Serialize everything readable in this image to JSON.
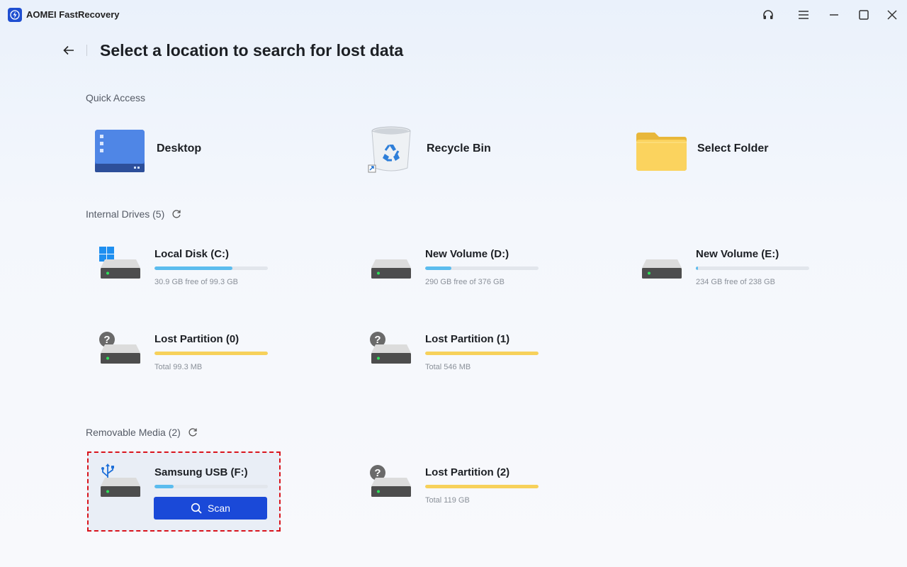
{
  "app": {
    "title": "AOMEI FastRecovery"
  },
  "header": {
    "title": "Select a location to search for lost data"
  },
  "quick_access": {
    "label": "Quick Access",
    "items": [
      {
        "label": "Desktop",
        "icon": "desktop-icon"
      },
      {
        "label": "Recycle Bin",
        "icon": "recycle-bin-icon"
      },
      {
        "label": "Select Folder",
        "icon": "folder-icon"
      }
    ]
  },
  "internal_drives": {
    "label": "Internal Drives (5)",
    "drives": [
      {
        "name": "Local Disk (C:)",
        "info": "30.9 GB free of 99.3 GB",
        "used_fraction": 0.69,
        "bar_color": "#5bbcee",
        "badge": "windows"
      },
      {
        "name": "New Volume (D:)",
        "info": "290 GB free of 376 GB",
        "used_fraction": 0.23,
        "bar_color": "#5bbcee",
        "badge": "none"
      },
      {
        "name": "New Volume (E:)",
        "info": "234 GB free of 238 GB",
        "used_fraction": 0.017,
        "bar_color": "#5bbcee",
        "badge": "none"
      },
      {
        "name": "Lost Partition (0)",
        "info": "Total 99.3 MB",
        "used_fraction": 1.0,
        "bar_color": "#f7d15a",
        "badge": "question"
      },
      {
        "name": "Lost Partition (1)",
        "info": "Total 546 MB",
        "used_fraction": 1.0,
        "bar_color": "#f7d15a",
        "badge": "question"
      }
    ]
  },
  "removable_media": {
    "label": "Removable Media (2)",
    "drives": [
      {
        "name": "Samsung USB (F:)",
        "used_fraction": 0.17,
        "bar_color": "#5bbcee",
        "badge": "usb",
        "selected": true
      },
      {
        "name": "Lost Partition (2)",
        "info": "Total 119 GB",
        "used_fraction": 1.0,
        "bar_color": "#f7d15a",
        "badge": "question"
      }
    ]
  },
  "scan_button": {
    "label": "Scan"
  },
  "colors": {
    "accent": "#1a49d8",
    "selection_border": "#d9141c"
  }
}
